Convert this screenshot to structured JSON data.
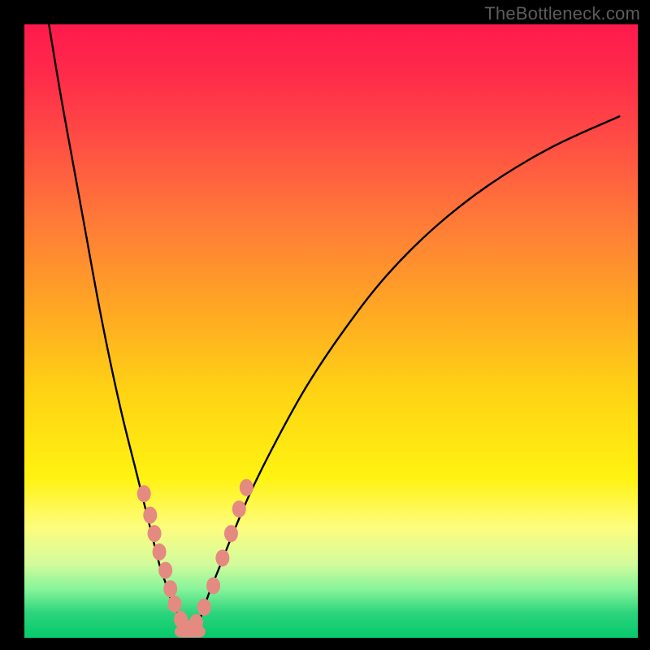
{
  "watermark": {
    "text": "TheBottleneck.com"
  },
  "chart_data": {
    "type": "line",
    "title": "",
    "xlabel": "",
    "ylabel": "",
    "xlim": [
      0,
      100
    ],
    "ylim": [
      0,
      100
    ],
    "series": [
      {
        "name": "left-curve",
        "x": [
          4,
          6,
          8,
          10,
          12,
          14,
          16,
          18,
          20,
          22,
          23,
          24,
          25,
          26,
          27
        ],
        "y": [
          100,
          88,
          77,
          66,
          55,
          45,
          36,
          28,
          20,
          12,
          9,
          6,
          4,
          2,
          1
        ]
      },
      {
        "name": "right-curve",
        "x": [
          27,
          28,
          29,
          30,
          32,
          34,
          37,
          41,
          46,
          52,
          59,
          67,
          76,
          86,
          97
        ],
        "y": [
          1,
          2,
          4,
          7,
          12,
          17,
          24,
          32,
          41,
          50,
          59,
          67,
          74,
          80,
          85
        ]
      }
    ],
    "markers": {
      "name": "data-points",
      "color": "#e58a80",
      "x": [
        19.5,
        20.5,
        21.2,
        22.0,
        23.0,
        23.8,
        24.5,
        25.5,
        26.5,
        28.0,
        29.3,
        30.8,
        32.3,
        33.7,
        35.0,
        36.2
      ],
      "y": [
        23.5,
        20.0,
        17.0,
        14.0,
        11.0,
        8.0,
        5.5,
        3.0,
        1.5,
        2.5,
        5.0,
        8.5,
        13.0,
        17.0,
        21.0,
        24.5
      ]
    },
    "minimum_band": {
      "name": "bottom-bar",
      "color": "#e58a80",
      "x_start": 24.5,
      "x_end": 29.5,
      "y": 1.0
    }
  }
}
